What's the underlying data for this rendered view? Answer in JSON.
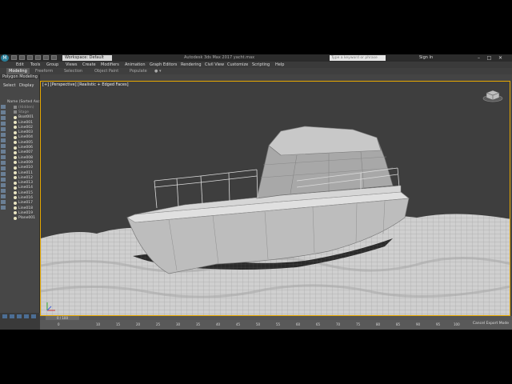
{
  "titlebar": {
    "workspace": "Workspace: Default",
    "window_title": "Autodesk 3ds Max 2017   yacht.max",
    "search_placeholder": "Type a keyword or phrase",
    "signin": "Sign In",
    "minimize": "–",
    "maximize": "□",
    "close": "✕"
  },
  "menu": [
    "Edit",
    "Tools",
    "Group",
    "Views",
    "Create",
    "Modifiers",
    "Animation",
    "Graph Editors",
    "Rendering",
    "Civil View",
    "Customize",
    "Scripting",
    "Help"
  ],
  "ribbon_tabs": [
    "Modeling",
    "Freeform",
    "Selection",
    "Object Paint",
    "Populate"
  ],
  "ribbon_panel": "Polygon Modeling",
  "scene_explorer": {
    "tabs": [
      "Select",
      "Display"
    ],
    "header": "Name (Sorted Ascen",
    "items": [
      "(Hidden)",
      "Stage",
      "Boat001",
      "Line001",
      "Line002",
      "Line003",
      "Line004",
      "Line005",
      "Line006",
      "Line007",
      "Line008",
      "Line009",
      "Line010",
      "Line011",
      "Line012",
      "Line013",
      "Line014",
      "Line015",
      "Line016",
      "Line017",
      "Line018",
      "Line019",
      "Plane001"
    ]
  },
  "viewport": {
    "label": "[+] [Perspective] [Realistic + Edged Faces]"
  },
  "timeline": {
    "frame": "0 / 100",
    "ticks": [
      "0",
      "10",
      "15",
      "20",
      "25",
      "30",
      "35",
      "40",
      "45",
      "50",
      "55",
      "60",
      "65",
      "70",
      "75",
      "80",
      "85",
      "90",
      "95",
      "100"
    ]
  },
  "status": {
    "caster": "Cancel Export Mode"
  },
  "colors": {
    "viewport_border": "#e6a800",
    "accent": "#4c6e95"
  }
}
